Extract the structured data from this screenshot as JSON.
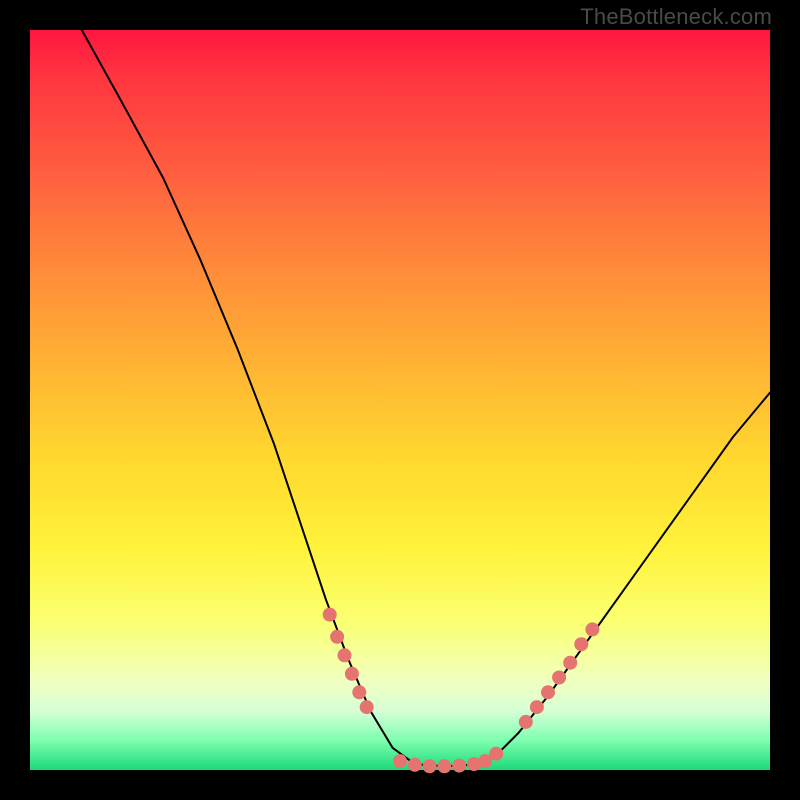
{
  "watermark": "TheBottleneck.com",
  "chart_data": {
    "type": "line",
    "title": "",
    "xlabel": "",
    "ylabel": "",
    "xlim": [
      0,
      100
    ],
    "ylim": [
      0,
      100
    ],
    "curve": [
      {
        "x": 7,
        "y": 100
      },
      {
        "x": 12,
        "y": 91
      },
      {
        "x": 18,
        "y": 80
      },
      {
        "x": 23,
        "y": 69
      },
      {
        "x": 28,
        "y": 57
      },
      {
        "x": 33,
        "y": 44
      },
      {
        "x": 37,
        "y": 32
      },
      {
        "x": 40,
        "y": 23
      },
      {
        "x": 43,
        "y": 15
      },
      {
        "x": 46,
        "y": 8
      },
      {
        "x": 49,
        "y": 3
      },
      {
        "x": 52,
        "y": 0.8
      },
      {
        "x": 56,
        "y": 0.5
      },
      {
        "x": 60,
        "y": 0.7
      },
      {
        "x": 63,
        "y": 2
      },
      {
        "x": 66,
        "y": 5
      },
      {
        "x": 70,
        "y": 10
      },
      {
        "x": 75,
        "y": 17
      },
      {
        "x": 80,
        "y": 24
      },
      {
        "x": 85,
        "y": 31
      },
      {
        "x": 90,
        "y": 38
      },
      {
        "x": 95,
        "y": 45
      },
      {
        "x": 100,
        "y": 51
      }
    ],
    "data_points": [
      {
        "x": 40.5,
        "y": 21
      },
      {
        "x": 41.5,
        "y": 18
      },
      {
        "x": 42.5,
        "y": 15.5
      },
      {
        "x": 43.5,
        "y": 13
      },
      {
        "x": 44.5,
        "y": 10.5
      },
      {
        "x": 45.5,
        "y": 8.5
      },
      {
        "x": 50,
        "y": 1.2
      },
      {
        "x": 52,
        "y": 0.7
      },
      {
        "x": 54,
        "y": 0.5
      },
      {
        "x": 56,
        "y": 0.5
      },
      {
        "x": 58,
        "y": 0.6
      },
      {
        "x": 60,
        "y": 0.8
      },
      {
        "x": 61.5,
        "y": 1.2
      },
      {
        "x": 63,
        "y": 2.2
      },
      {
        "x": 67,
        "y": 6.5
      },
      {
        "x": 68.5,
        "y": 8.5
      },
      {
        "x": 70,
        "y": 10.5
      },
      {
        "x": 71.5,
        "y": 12.5
      },
      {
        "x": 73,
        "y": 14.5
      },
      {
        "x": 74.5,
        "y": 17
      },
      {
        "x": 76,
        "y": 19
      }
    ],
    "point_color": "#e5736f"
  }
}
